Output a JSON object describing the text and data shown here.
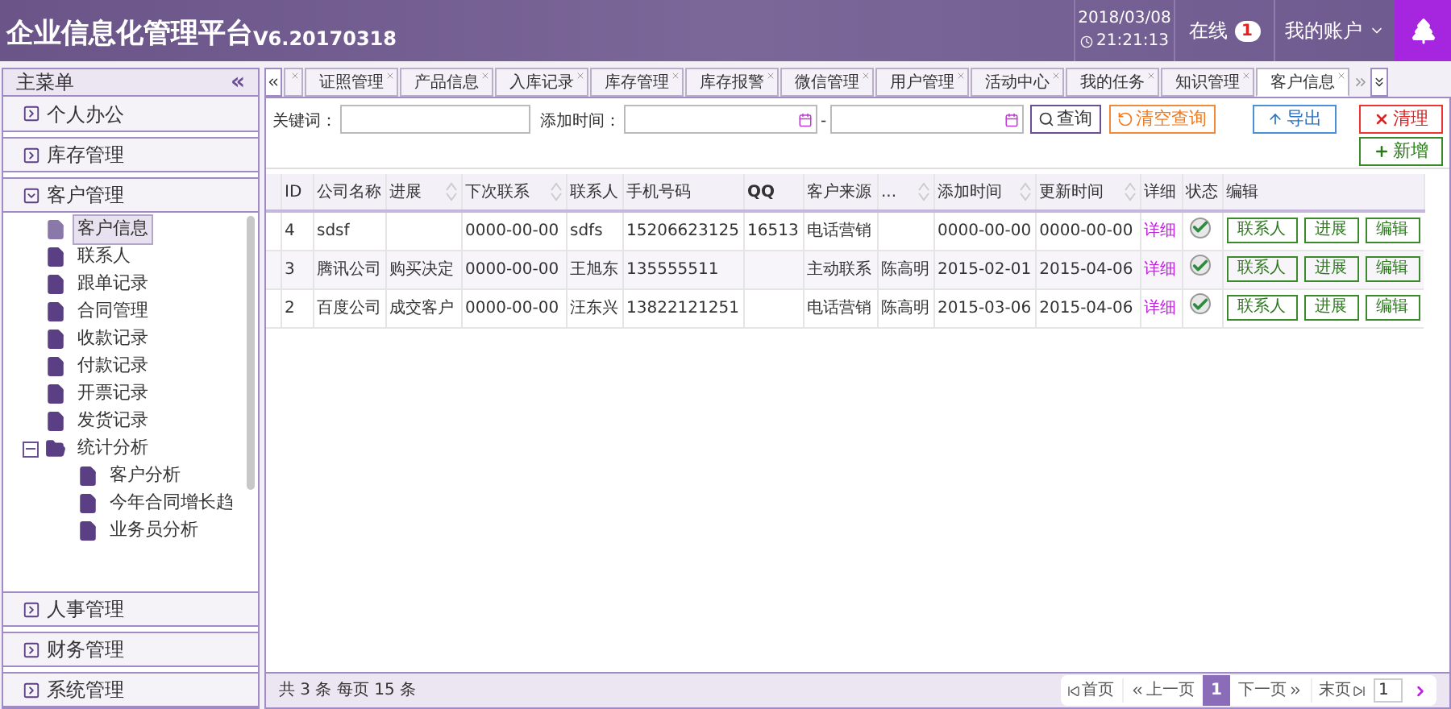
{
  "header": {
    "title": "企业信息化管理平台",
    "version": "V6.20170318",
    "date": "2018/03/08",
    "time": "21:21:13",
    "online_label": "在线",
    "online_count": "1",
    "account": "我的账户"
  },
  "sidebar": {
    "title": "主菜单",
    "collapse": "«",
    "sections": [
      {
        "label": "个人办公",
        "expanded": false
      },
      {
        "label": "库存管理",
        "expanded": false
      },
      {
        "label": "客户管理",
        "expanded": true,
        "tree": [
          {
            "label": "客户信息",
            "selected": true
          },
          {
            "label": "联系人",
            "selected": false
          },
          {
            "label": "跟单记录",
            "selected": false
          },
          {
            "label": "合同管理",
            "selected": false
          },
          {
            "label": "收款记录",
            "selected": false
          },
          {
            "label": "付款记录",
            "selected": false
          },
          {
            "label": "开票记录",
            "selected": false
          },
          {
            "label": "发货记录",
            "selected": false
          },
          {
            "label": "统计分析",
            "selected": false,
            "expanded": true,
            "children": [
              {
                "label": "客户分析",
                "selected": false
              },
              {
                "label": "今年合同增长趋",
                "selected": false
              },
              {
                "label": "业务员分析",
                "selected": false
              }
            ]
          }
        ]
      },
      {
        "label": "人事管理",
        "expanded": false
      },
      {
        "label": "财务管理",
        "expanded": false
      },
      {
        "label": "系统管理",
        "expanded": false
      }
    ]
  },
  "tabs": [
    {
      "label": "证照管理",
      "selected": false
    },
    {
      "label": "产品信息",
      "selected": false
    },
    {
      "label": "入库记录",
      "selected": false
    },
    {
      "label": "库存管理",
      "selected": false
    },
    {
      "label": "库存报警",
      "selected": false
    },
    {
      "label": "微信管理",
      "selected": false
    },
    {
      "label": "用户管理",
      "selected": false
    },
    {
      "label": "活动中心",
      "selected": false
    },
    {
      "label": "我的任务",
      "selected": false
    },
    {
      "label": "知识管理",
      "selected": false
    },
    {
      "label": "客户信息",
      "selected": true
    }
  ],
  "search": {
    "keyword_label": "关键词：",
    "time_label": "添加时间：",
    "range_sep": "-",
    "query": "查询",
    "clear": "清空查询",
    "export": "导出",
    "reset": "清理",
    "add": "新增"
  },
  "table": {
    "columns": [
      {
        "label": "ID",
        "sortable": false
      },
      {
        "label": "公司名称",
        "sortable": false
      },
      {
        "label": "进展",
        "sortable": true
      },
      {
        "label": "下次联系",
        "sortable": true
      },
      {
        "label": "联系人",
        "sortable": false
      },
      {
        "label": "手机号码",
        "sortable": false
      },
      {
        "label": "QQ",
        "sortable": false
      },
      {
        "label": "客户来源",
        "sortable": false
      },
      {
        "label": "...",
        "sortable": true
      },
      {
        "label": "添加时间",
        "sortable": true
      },
      {
        "label": "更新时间",
        "sortable": true
      },
      {
        "label": "详细",
        "sortable": false
      },
      {
        "label": "状态",
        "sortable": false
      },
      {
        "label": "编辑",
        "sortable": false
      }
    ],
    "rows": [
      {
        "cells": [
          "4",
          "sdsf",
          "",
          "0000-00-00",
          "sdfs",
          "15206623125",
          "16513",
          "电话营销",
          "",
          "0000-00-00",
          "0000-00-00"
        ],
        "detail": "详细",
        "checked": true,
        "actions": [
          "联系人",
          "进展",
          "编辑"
        ]
      },
      {
        "cells": [
          "3",
          "腾讯公司",
          "购买决定",
          "0000-00-00",
          "王旭东",
          "135555511",
          "",
          "主动联系",
          "陈高明",
          "2015-02-01",
          "2015-04-06"
        ],
        "detail": "详细",
        "checked": true,
        "actions": [
          "联系人",
          "进展",
          "编辑"
        ]
      },
      {
        "cells": [
          "2",
          "百度公司",
          "成交客户",
          "0000-00-00",
          "汪东兴",
          "13822121251",
          "",
          "电话营销",
          "陈高明",
          "2015-03-06",
          "2015-04-06"
        ],
        "detail": "详细",
        "checked": true,
        "actions": [
          "联系人",
          "进展",
          "编辑"
        ]
      }
    ]
  },
  "footer": {
    "summary": "共 3 条 每页 15 条",
    "first": "首页",
    "prev": "上一页",
    "page": "1",
    "next": "下一页",
    "last": "末页",
    "page_input": "1"
  }
}
